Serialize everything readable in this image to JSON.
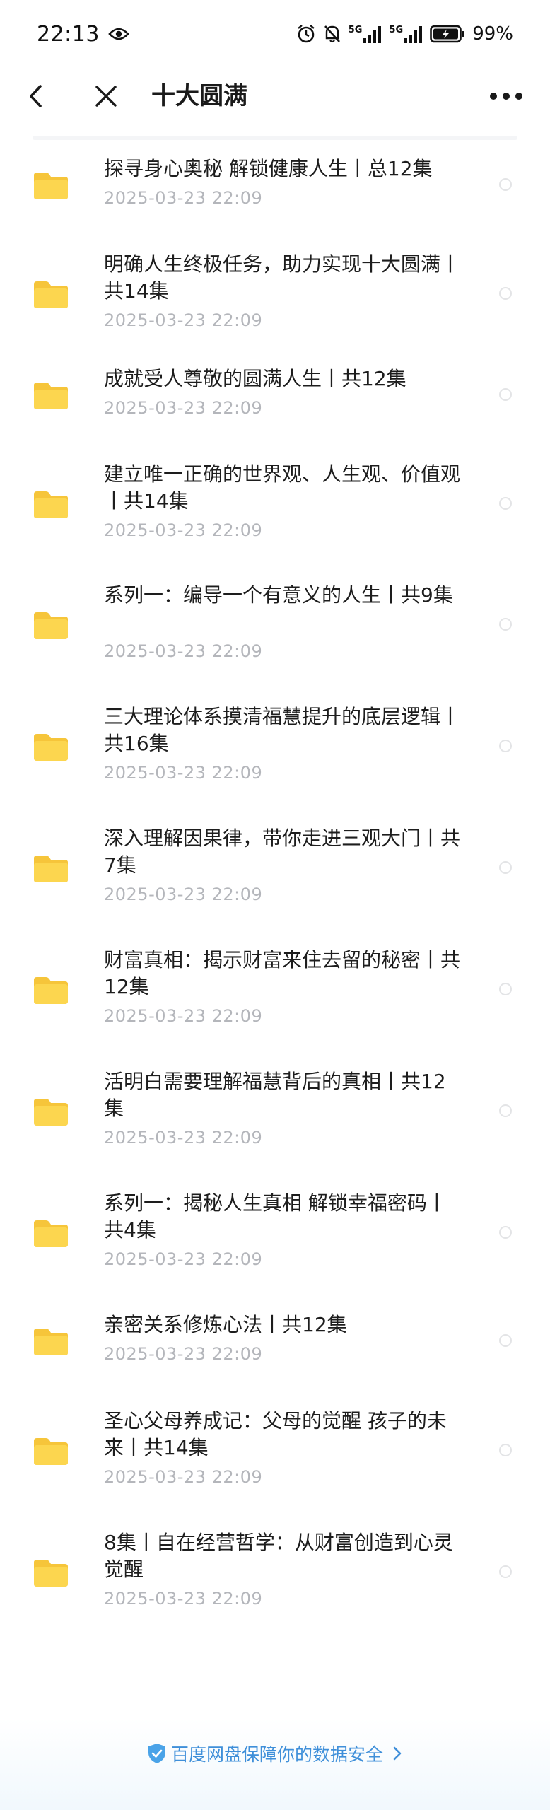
{
  "status_bar": {
    "time": "22:13",
    "network1": "5G",
    "network2": "5G",
    "battery_percent": "99%"
  },
  "nav": {
    "title": "十大圆满"
  },
  "files": [
    {
      "title": "探寻身心奥秘 解锁健康人生丨总12集",
      "date": "2025-03-23  22:09"
    },
    {
      "title": "明确人生终极任务，助力实现十大圆满丨共14集",
      "date": "2025-03-23  22:09"
    },
    {
      "title": "成就受人尊敬的圆满人生丨共12集",
      "date": "2025-03-23  22:09"
    },
    {
      "title": "建立唯一正确的世界观、人生观、价值观丨共14集",
      "date": "2025-03-23  22:09"
    },
    {
      "title": "系列一：编导一个有意义的人生丨共9集",
      "date": "2025-03-23  22:09"
    },
    {
      "title": "三大理论体系摸清福慧提升的底层逻辑丨共16集",
      "date": "2025-03-23  22:09"
    },
    {
      "title": "深入理解因果律，带你走进三观大门丨共7集",
      "date": "2025-03-23  22:09"
    },
    {
      "title": "财富真相：揭示财富来住去留的秘密丨共12集",
      "date": "2025-03-23  22:09"
    },
    {
      "title": "活明白需要理解福慧背后的真相丨共12集",
      "date": "2025-03-23  22:09"
    },
    {
      "title": "系列一：揭秘人生真相 解锁幸福密码丨共4集",
      "date": "2025-03-23  22:09"
    },
    {
      "title": "亲密关系修炼心法丨共12集",
      "date": "2025-03-23  22:09"
    },
    {
      "title": "圣心父母养成记：父母的觉醒 孩子的未来丨共14集",
      "date": "2025-03-23  22:09"
    },
    {
      "title": "8集丨自在经营哲学：从财富创造到心灵觉醒",
      "date": "2025-03-23  22:09"
    }
  ],
  "footer": {
    "text": "百度网盘保障你的数据安全"
  },
  "colors": {
    "folder": "#fcd64f",
    "folder_tab": "#f6c53a",
    "footer_accent": "#3f8fd9",
    "date": "#b4b6bb"
  }
}
